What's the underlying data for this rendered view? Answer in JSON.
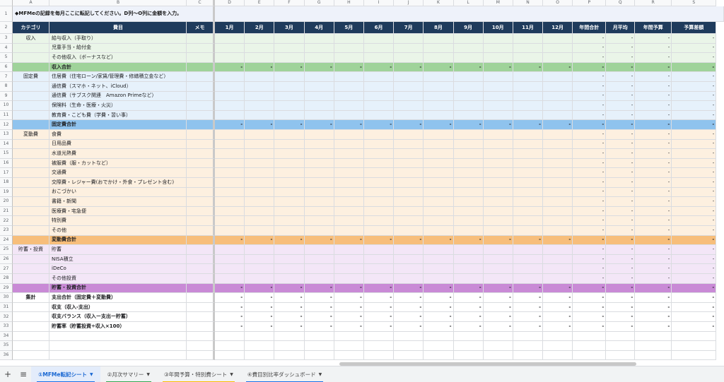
{
  "col_letters": [
    "A",
    "B",
    "C",
    "D",
    "E",
    "F",
    "G",
    "H",
    "I",
    "J",
    "K",
    "L",
    "M",
    "N",
    "O",
    "P",
    "Q",
    "R",
    "S"
  ],
  "row1_note": "◆MFMeの記録を毎月ここに転記してください。D列〜O列に金額を入力。",
  "headers": [
    "カテゴリ",
    "費目",
    "メモ",
    "1月",
    "2月",
    "3月",
    "4月",
    "5月",
    "6月",
    "7月",
    "8月",
    "9月",
    "10月",
    "11月",
    "12月",
    "年間合計",
    "月平均",
    "年間予算",
    "予算差額"
  ],
  "rows": [
    {
      "n": "3",
      "cat": "収入",
      "item": "給与収入（手取り）",
      "t": "inc",
      "d": "PQRS"
    },
    {
      "n": "4",
      "cat": "",
      "item": "児童手当・給付金",
      "t": "inc",
      "d": "PQRS"
    },
    {
      "n": "5",
      "cat": "",
      "item": "その他収入（ボーナスなど）",
      "t": "inc",
      "d": "PQRS"
    },
    {
      "n": "6",
      "cat": "",
      "item": "収入合計",
      "t": "incT",
      "d": "DEFGHIJKLMNOPQRS"
    },
    {
      "n": "7",
      "cat": "固定費",
      "item": "住居費（住宅ローン/家賃/管理費・修繕積立金など）",
      "t": "fix",
      "d": "PQRS"
    },
    {
      "n": "8",
      "cat": "",
      "item": "通信費（スマホ・ネット、iCloud）",
      "t": "fix",
      "d": "PQRS"
    },
    {
      "n": "9",
      "cat": "",
      "item": "通信費（サブスク関連　Amazon Primeなど）",
      "t": "fix",
      "d": "PQRS"
    },
    {
      "n": "10",
      "cat": "",
      "item": "保険料（生命・医療・火災）",
      "t": "fix",
      "d": "PQRS"
    },
    {
      "n": "11",
      "cat": "",
      "item": "教育費・こども費（学費・習い事）",
      "t": "fix",
      "d": "PQRS"
    },
    {
      "n": "12",
      "cat": "",
      "item": "固定費合計",
      "t": "fixT",
      "d": "DEFGHIJKLMNOPQRS"
    },
    {
      "n": "13",
      "cat": "変動費",
      "item": "食費",
      "t": "var",
      "d": "PQRS"
    },
    {
      "n": "14",
      "cat": "",
      "item": "日用品費",
      "t": "var",
      "d": "PQRS"
    },
    {
      "n": "15",
      "cat": "",
      "item": "水道光熱費",
      "t": "var",
      "d": "PQRS"
    },
    {
      "n": "16",
      "cat": "",
      "item": "被服費（服・カットなど）",
      "t": "var",
      "d": "PQRS"
    },
    {
      "n": "17",
      "cat": "",
      "item": "交通費",
      "t": "var",
      "d": "PQRS"
    },
    {
      "n": "18",
      "cat": "",
      "item": "交際費・レジャー費(おでかけ・外食・プレゼント含む)",
      "t": "var",
      "d": "PQRS"
    },
    {
      "n": "19",
      "cat": "",
      "item": "おこづかい",
      "t": "var",
      "d": "PQRS"
    },
    {
      "n": "20",
      "cat": "",
      "item": "書籍・新聞",
      "t": "var",
      "d": "PQRS"
    },
    {
      "n": "21",
      "cat": "",
      "item": "医療費・宅急便",
      "t": "var",
      "d": "PQRS"
    },
    {
      "n": "22",
      "cat": "",
      "item": "特別費",
      "t": "var",
      "d": "PQRS"
    },
    {
      "n": "23",
      "cat": "",
      "item": "その他",
      "t": "var",
      "d": "PQRS"
    },
    {
      "n": "24",
      "cat": "",
      "item": "変動費合計",
      "t": "varT",
      "d": "DEFGHIJKLMNOPQRS"
    },
    {
      "n": "25",
      "cat": "貯蓄・投資",
      "item": "貯蓄",
      "t": "sav",
      "d": "PQRS"
    },
    {
      "n": "26",
      "cat": "",
      "item": "NISA積立",
      "t": "sav",
      "d": "PQRS"
    },
    {
      "n": "27",
      "cat": "",
      "item": "iDeCo",
      "t": "sav",
      "d": "PQRS"
    },
    {
      "n": "28",
      "cat": "",
      "item": "その他投資",
      "t": "sav",
      "d": "PQRS"
    },
    {
      "n": "29",
      "cat": "",
      "item": "貯蓄・投資合計",
      "t": "savT",
      "d": "DEFGHIJKLMNOPQRS"
    },
    {
      "n": "30",
      "cat": "集計",
      "item": "支出合計（固定費＋変動費）",
      "t": "tot",
      "d": "DEFGHIJKLMNOPQRS"
    },
    {
      "n": "31",
      "cat": "",
      "item": "収支（収入-支出）",
      "t": "tot",
      "d": "DEFGHIJKLMNOPQRS"
    },
    {
      "n": "32",
      "cat": "",
      "item": "収支バランス（収入ー支出ー貯蓄）",
      "t": "tot",
      "d": "DEFGHIJKLMNOPQRS"
    },
    {
      "n": "33",
      "cat": "",
      "item": "貯蓄率（貯蓄投資÷収入×100）",
      "t": "tot",
      "d": "DEFGHIJKLMNOPQRS"
    },
    {
      "n": "34",
      "cat": "",
      "item": "",
      "t": "emp",
      "d": ""
    },
    {
      "n": "35",
      "cat": "",
      "item": "",
      "t": "emp",
      "d": ""
    },
    {
      "n": "36",
      "cat": "",
      "item": "",
      "t": "emp",
      "d": ""
    }
  ],
  "dash": "-",
  "tabs": [
    {
      "label": "①MFMe転記シート",
      "active": true,
      "color": "#1a73e8"
    },
    {
      "label": "②月次サマリー",
      "active": false,
      "color": "#34a853"
    },
    {
      "label": "③年間予算・特別費シート",
      "active": false,
      "color": "#fbbc04"
    },
    {
      "label": "④費目別比率ダッシュボード",
      "active": false,
      "color": "#1a73e8"
    }
  ],
  "add_sheet_icon": "plus-icon",
  "all_sheets_icon": "menu-icon",
  "dropdown_icon": "caret-down-icon"
}
